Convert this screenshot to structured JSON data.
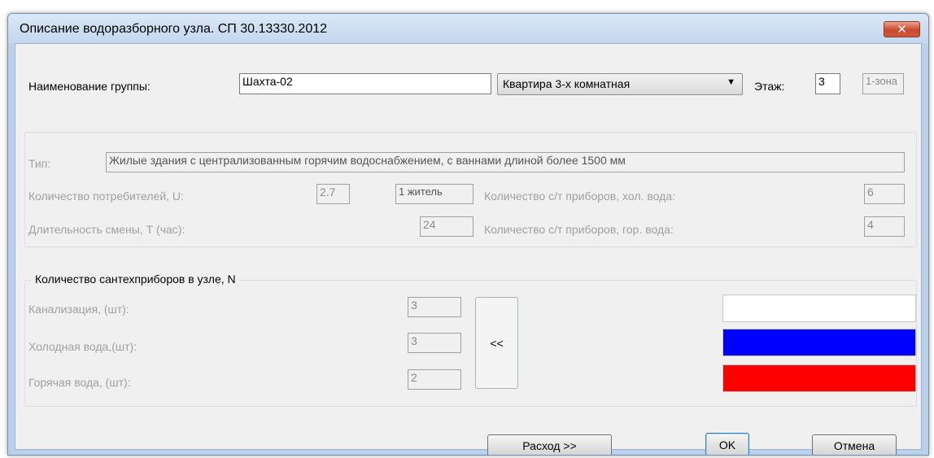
{
  "window": {
    "title": "Описание водоразборного узла. СП 30.13330.2012",
    "close_glyph": "✕"
  },
  "header": {
    "group_name_label": "Наименование группы:",
    "group_name_value": "Шахта-02",
    "apartment_type": "Квартира 3-х комнатная",
    "floor_label": "Этаж:",
    "floor_value": "3",
    "zone_value": "1-зона"
  },
  "info": {
    "type_label": "Тип:",
    "type_value": "Жилые здания с централизованным горячим водоснабжением, с ваннами длиной более 1500 мм",
    "consumers_label": "Количество потребителей, U:",
    "consumers_value": "2.7",
    "consumers_unit": "1 житель",
    "shift_label": "Длительность смены, Т (час):",
    "shift_value": "24",
    "cold_devices_label": "Количество с/т приборов, хол. вода:",
    "cold_devices_value": "6",
    "hot_devices_label": "Количество с/т приборов, гор. вода:",
    "hot_devices_value": "4"
  },
  "fixtures": {
    "title": "Количество сантехприборов в узле, N",
    "sewer_label": "Канализация, (шт):",
    "sewer_value": "3",
    "cold_label": "Холодная вода,(шт):",
    "cold_value": "3",
    "hot_label": "Горячая  вода, (шт):",
    "hot_value": "2",
    "transfer_button": "<<",
    "colors": {
      "sewer": "#ffffff",
      "cold": "#0000ff",
      "hot": "#ff0000"
    }
  },
  "buttons": {
    "flow": "Расход >>",
    "ok": "OK",
    "cancel": "Отмена"
  }
}
